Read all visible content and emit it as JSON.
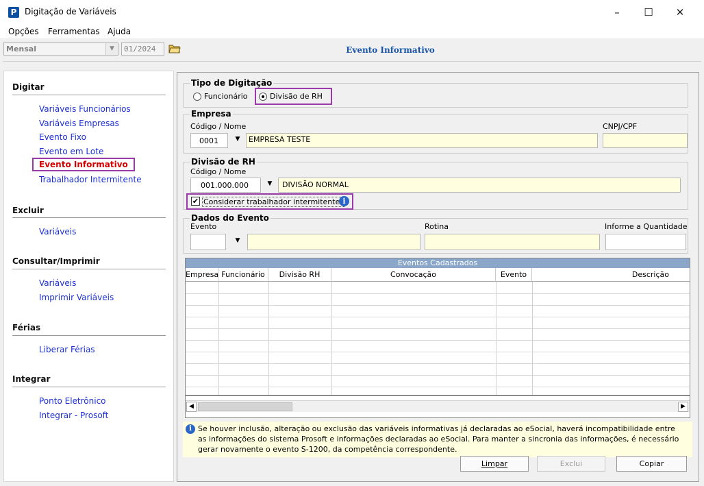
{
  "window": {
    "title": "Digitação de Variáveis",
    "icon_letter": "P",
    "minimize": "–",
    "maximize": "☐",
    "close": "✕"
  },
  "menu": [
    "Opções",
    "Ferramentas",
    "Ajuda"
  ],
  "toolbar": {
    "period": "Mensal",
    "competence": "01/2024",
    "page_title": "Evento Informativo"
  },
  "nav": {
    "digitar": {
      "title": "Digitar",
      "items": [
        "Variáveis Funcionários",
        "Variáveis Empresas",
        "Evento Fixo",
        "Evento em Lote",
        "Evento Informativo",
        "Trabalhador Intermitente"
      ]
    },
    "excluir": {
      "title": "Excluir",
      "items": [
        "Variáveis"
      ]
    },
    "consultar": {
      "title": "Consultar/Imprimir",
      "items": [
        "Variáveis",
        "Imprimir Variáveis"
      ]
    },
    "ferias": {
      "title": "Férias",
      "items": [
        "Liberar Férias"
      ]
    },
    "integrar": {
      "title": "Integrar",
      "items": [
        "Ponto Eletrônico",
        "Integrar - Prosoft"
      ]
    }
  },
  "tipo": {
    "title": "Tipo de Digitação",
    "opt1": "Funcionário",
    "opt2": "Divisão de RH",
    "selected": "Divisão de RH"
  },
  "empresa": {
    "title": "Empresa",
    "code_label": "Código / Nome",
    "code": "0001",
    "name": "EMPRESA TESTE",
    "cnpj_label": "CNPJ/CPF",
    "cnpj": ""
  },
  "divisao": {
    "title": "Divisão de RH",
    "code_label": "Código / Nome",
    "code": "001.000.000",
    "name": "DIVISÃO NORMAL",
    "checkbox_label": "Considerar trabalhador intermitente?",
    "checked": true
  },
  "dados": {
    "title": "Dados do Evento",
    "evento_label": "Evento",
    "rotina_label": "Rotina",
    "quantidade_label": "Informe a Quantidade"
  },
  "grid": {
    "title": "Eventos Cadastrados",
    "columns": [
      "Empresa",
      "Funcionário",
      "Divisão RH",
      "Convocação",
      "Evento",
      "Descrição"
    ]
  },
  "info": "Se houver inclusão, alteração ou exclusão das variáveis informativas já declaradas ao eSocial, haverá incompatibilidade entre as informações do sistema Prosoft e informações declaradas ao eSocial. Para manter a sincronia das informações, é necessário gerar novamente o evento S-1200, da competência correspondente.",
  "buttons": {
    "limpar": "Limpar",
    "exclui": "Exclui",
    "copiar": "Copiar"
  }
}
